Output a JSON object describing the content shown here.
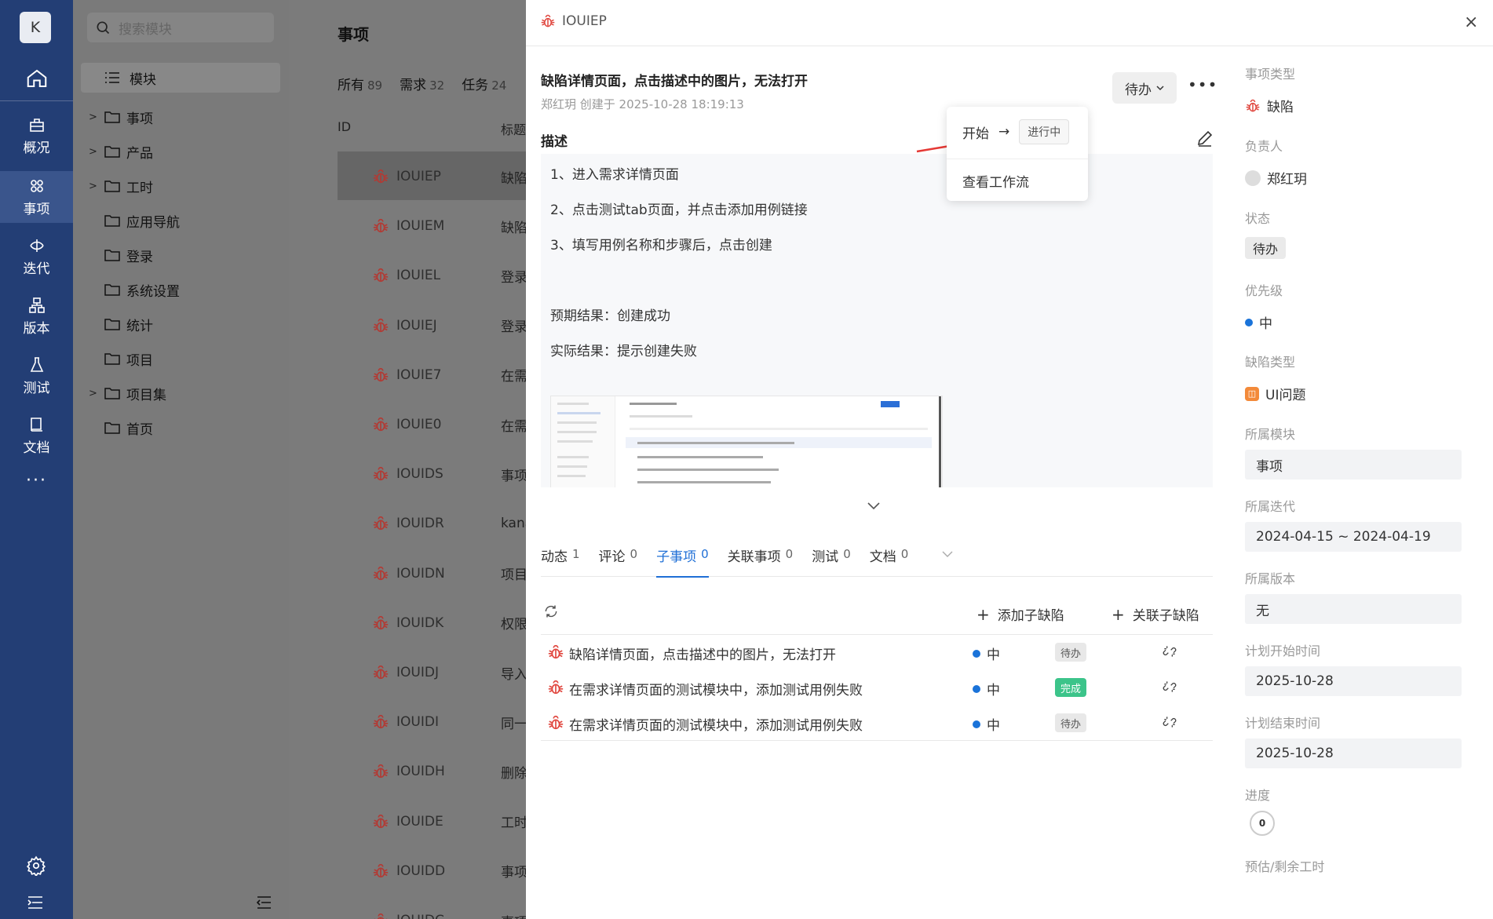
{
  "rail": {
    "avatar_letter": "K",
    "items": [
      {
        "label": "概况",
        "icon": "overview-icon"
      },
      {
        "label": "事项",
        "icon": "workitem-icon",
        "active": true
      },
      {
        "label": "迭代",
        "icon": "sprint-icon"
      },
      {
        "label": "版本",
        "icon": "version-icon"
      },
      {
        "label": "测试",
        "icon": "test-icon"
      },
      {
        "label": "文档",
        "icon": "doc-icon"
      }
    ],
    "more": "···"
  },
  "tree": {
    "search_placeholder": "搜索模块",
    "title": "模块",
    "items": [
      {
        "label": "事项",
        "expandable": true
      },
      {
        "label": "产品",
        "expandable": true
      },
      {
        "label": "工时",
        "expandable": true
      },
      {
        "label": "应用导航",
        "expandable": false
      },
      {
        "label": "登录",
        "expandable": false
      },
      {
        "label": "系统设置",
        "expandable": false
      },
      {
        "label": "统计",
        "expandable": false
      },
      {
        "label": "项目",
        "expandable": false
      },
      {
        "label": "项目集",
        "expandable": true
      },
      {
        "label": "首页",
        "expandable": false
      }
    ]
  },
  "list": {
    "title": "事项",
    "tabs": [
      {
        "label": "所有",
        "count": "89"
      },
      {
        "label": "需求",
        "count": "32"
      },
      {
        "label": "任务",
        "count": "24"
      }
    ],
    "col_id": "ID",
    "col_title": "标题",
    "rows": [
      {
        "id": "IOUIEP",
        "title": "缺陷"
      },
      {
        "id": "IOUIEM",
        "title": "缺陷"
      },
      {
        "id": "IOUIEL",
        "title": "登录"
      },
      {
        "id": "IOUIEJ",
        "title": "登录"
      },
      {
        "id": "IOUIE7",
        "title": "在需"
      },
      {
        "id": "IOUIE0",
        "title": "在需"
      },
      {
        "id": "IOUIDS",
        "title": "事项"
      },
      {
        "id": "IOUIDR",
        "title": "kana"
      },
      {
        "id": "IOUIDN",
        "title": "项目"
      },
      {
        "id": "IOUIDK",
        "title": "权限"
      },
      {
        "id": "IOUIDJ",
        "title": "导入"
      },
      {
        "id": "IOUIDI",
        "title": "同一"
      },
      {
        "id": "IOUIDH",
        "title": "删除"
      },
      {
        "id": "IOUIDE",
        "title": "工时"
      },
      {
        "id": "IOUIDD",
        "title": "事项"
      },
      {
        "id": "IOUIDC",
        "title": "事项"
      }
    ]
  },
  "drawer": {
    "code": "IOUIEP",
    "close": "×",
    "title": "缺陷详情页面，点击描述中的图片，无法打开",
    "meta": "郑红玥 创建于 2025-10-28 18:19:13",
    "status": "待办",
    "desc_label": "描述",
    "desc_lines": [
      "1、进入需求详情页面",
      "2、点击测试tab页面，并点击添加用例链接",
      "3、填写用例名称和步骤后，点击创建",
      "预期结果：创建成功",
      "实际结果：提示创建失败"
    ],
    "popup": {
      "start": "开始",
      "arrow": "→",
      "to_state": "进行中",
      "view_workflow": "查看工作流"
    },
    "tabs": [
      {
        "label": "动态",
        "count": "1"
      },
      {
        "label": "评论",
        "count": "0"
      },
      {
        "label": "子事项",
        "count": "0",
        "active": true
      },
      {
        "label": "关联事项",
        "count": "0"
      },
      {
        "label": "测试",
        "count": "0"
      },
      {
        "label": "文档",
        "count": "0"
      }
    ],
    "add_sub": "添加子缺陷",
    "link_sub": "关联子缺陷",
    "subitems": [
      {
        "title": "缺陷详情页面，点击描述中的图片，无法打开",
        "priority": "中",
        "status": "待办",
        "status_color": "#e8e8e8",
        "status_text_color": "#555"
      },
      {
        "title": "在需求详情页面的测试模块中，添加测试用例失败",
        "priority": "中",
        "status": "完成",
        "status_color": "#3cc48a",
        "status_text_color": "#ffffff"
      },
      {
        "title": "在需求详情页面的测试模块中，添加测试用例失败",
        "priority": "中",
        "status": "待办",
        "status_color": "#e8e8e8",
        "status_text_color": "#555"
      }
    ]
  },
  "side": {
    "type_label": "事项类型",
    "type_value": "缺陷",
    "owner_label": "负责人",
    "owner_value": "郑红玥",
    "status_label": "状态",
    "status_value": "待办",
    "priority_label": "优先级",
    "priority_value": "中",
    "bugtype_label": "缺陷类型",
    "bugtype_value": "UI问题",
    "module_label": "所属模块",
    "module_value": "事项",
    "sprint_label": "所属迭代",
    "sprint_value": "2024-04-15 ~ 2024-04-19",
    "version_label": "所属版本",
    "version_value": "无",
    "start_label": "计划开始时间",
    "start_value": "2025-10-28",
    "end_label": "计划结束时间",
    "end_value": "2025-10-28",
    "progress_label": "进度",
    "progress_value": "0",
    "estimate_label": "预估/剩余工时"
  },
  "colors": {
    "rail": "#233e75",
    "accent": "#1f6fd6",
    "bug": "#e0463e"
  }
}
